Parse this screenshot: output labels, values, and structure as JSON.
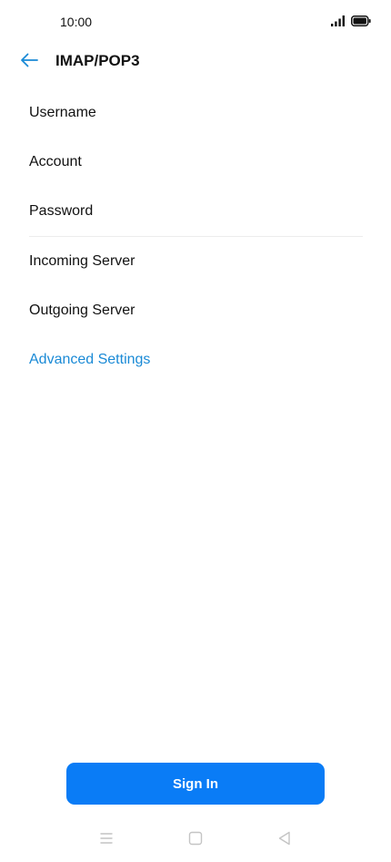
{
  "status_bar": {
    "time": "10:00",
    "icons": [
      "signal-icon",
      "battery-icon"
    ]
  },
  "app_bar": {
    "back_icon": "arrow-left-icon",
    "title": "IMAP/POP3"
  },
  "form": {
    "items": [
      {
        "label": "Username"
      },
      {
        "label": "Account"
      },
      {
        "label": "Password"
      },
      {
        "label": "Incoming Server"
      },
      {
        "label": "Outgoing Server"
      }
    ],
    "advanced_label": "Advanced Settings"
  },
  "sign_in": {
    "label": "Sign In"
  },
  "nav_bar": {
    "icons": [
      "menu-icon",
      "home-icon",
      "back-triangle-icon"
    ]
  },
  "colors": {
    "accent": "#1a8ad6",
    "button": "#0a7cf6",
    "text": "#111111",
    "divider": "#ececec"
  }
}
